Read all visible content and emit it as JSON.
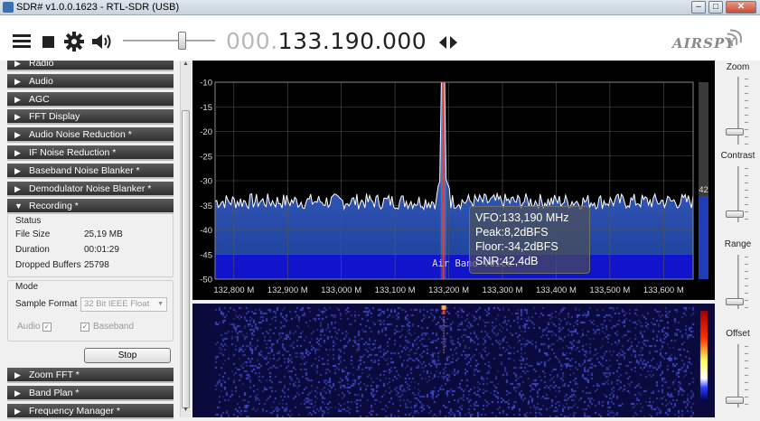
{
  "window": {
    "title": "SDR# v1.0.0.1623 - RTL-SDR (USB)",
    "minimize": "–",
    "maximize": "□",
    "close": "✕"
  },
  "toolbar": {
    "freq_dim": "000.",
    "freq_main": "133.190.000",
    "logo": "AIRSPY",
    "volume": 0.66
  },
  "panels": {
    "sections_top": [
      {
        "label": "Radio",
        "arrow": "▶"
      },
      {
        "label": "Audio",
        "arrow": "▶"
      },
      {
        "label": "AGC",
        "arrow": "▶"
      },
      {
        "label": "FFT Display",
        "arrow": "▶"
      },
      {
        "label": "Audio Noise Reduction *",
        "arrow": "▶"
      },
      {
        "label": "IF Noise Reduction *",
        "arrow": "▶"
      },
      {
        "label": "Baseband Noise Blanker *",
        "arrow": "▶"
      },
      {
        "label": "Demodulator Noise Blanker *",
        "arrow": "▶"
      },
      {
        "label": "Recording *",
        "arrow": "▼"
      }
    ],
    "sections_bottom": [
      {
        "label": "Zoom FFT *",
        "arrow": "▶"
      },
      {
        "label": "Band Plan *",
        "arrow": "▶"
      },
      {
        "label": "Frequency Manager *",
        "arrow": "▶"
      }
    ],
    "recording": {
      "status_title": "Status",
      "file_size_label": "File Size",
      "file_size_value": "25,19 MB",
      "duration_label": "Duration",
      "duration_value": "00:01:29",
      "dropped_label": "Dropped Buffers",
      "dropped_value": "25798",
      "mode_title": "Mode",
      "sample_format_label": "Sample Format",
      "sample_format_value": "32 Bit IEEE Float",
      "audio_label": "Audio",
      "baseband_label": "Baseband",
      "stop_label": "Stop"
    }
  },
  "chart_data": {
    "type": "line",
    "x_ticks": [
      "132,800 M",
      "132,900 M",
      "133,000 M",
      "133,100 M",
      "133,200 M",
      "133,300 M",
      "133,400 M",
      "133,500 M",
      "133,600 M"
    ],
    "x_tick_values": [
      132.8,
      132.9,
      133.0,
      133.1,
      133.2,
      133.3,
      133.4,
      133.5,
      133.6
    ],
    "y_ticks": [
      "-10",
      "-15",
      "-20",
      "-25",
      "-30",
      "-35",
      "-40",
      "-45",
      "-50"
    ],
    "y_tick_values": [
      -10,
      -15,
      -20,
      -25,
      -30,
      -35,
      -40,
      -45,
      -50
    ],
    "xlim": [
      132.765,
      133.655
    ],
    "ylim": [
      -50,
      -10
    ],
    "noise_floor_db": -34.2,
    "peak_freq": 133.19,
    "peak_db": -10,
    "band_label": "Air Band Voice",
    "band_range": [
      132.765,
      133.655
    ],
    "band_db_range": [
      -50,
      -45
    ],
    "snr_bar_value": "42",
    "grid": true
  },
  "tooltip": {
    "vfo": "VFO:133,190 MHz",
    "peak": "Peak:8,2dBFS",
    "floor": "Floor:-34,2dBFS",
    "snr": "SNR:42,4dB"
  },
  "sliders": {
    "zoom_label": "Zoom",
    "contrast_label": "Contrast",
    "range_label": "Range",
    "offset_label": "Offset"
  },
  "colors": {
    "spectrum_fill": "#1a3f9a",
    "spectrum_line": "#ffffff",
    "band_plan": "#1010d0",
    "vfo_line": "#e04040",
    "waterfall_bg": "#0a0a3c"
  }
}
